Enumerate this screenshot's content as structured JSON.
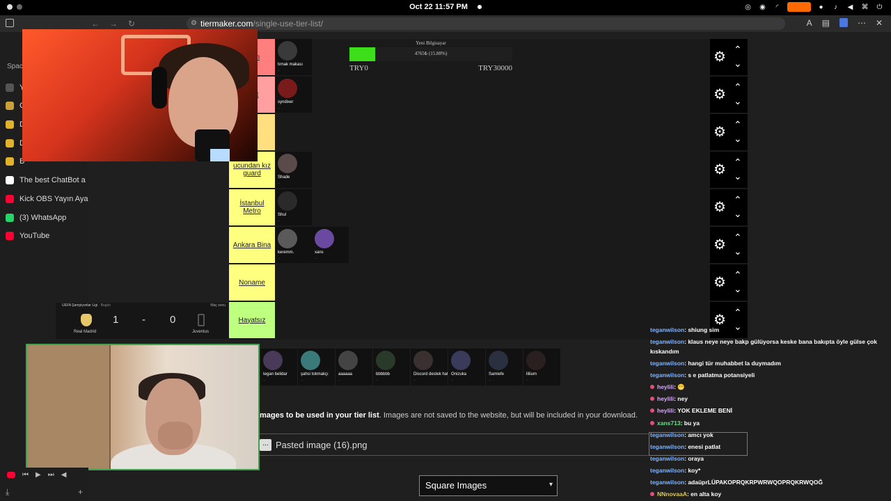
{
  "os": {
    "clock": "Oct 22  11:57 PM"
  },
  "browser": {
    "url_domain": "tiermaker.com",
    "url_path": "/single-use-tier-list/",
    "nav_back": "←",
    "nav_forward": "→",
    "reload": "↻",
    "close": "✕",
    "more": "⋯"
  },
  "sidebar": {
    "spaces_label": "Spac",
    "items": [
      {
        "label": "Y",
        "icon": "plus-icon"
      },
      {
        "label": "C",
        "icon": "tab-icon"
      },
      {
        "label": "D",
        "icon": "favicon"
      },
      {
        "label": "D",
        "icon": "favicon"
      },
      {
        "label": "B",
        "icon": "favicon"
      },
      {
        "label": "The best ChatBot a",
        "icon": "chatbot-icon"
      },
      {
        "label": "Kick OBS Yayın Aya",
        "icon": "youtube-icon"
      },
      {
        "label": "(3) WhatsApp",
        "icon": "whatsapp-icon"
      },
      {
        "label": "YouTube",
        "icon": "youtube-icon"
      }
    ],
    "download": "⤓",
    "add": "+"
  },
  "tiers": [
    {
      "label": "nden",
      "color": "#ff7f7f",
      "items": [
        {
          "name": "tırnak makası",
          "sub": "..."
        }
      ]
    },
    {
      "label": "ayat",
      "color": "#ff9f9f",
      "items": [
        {
          "name": "syndixer",
          "sub": "..."
        }
      ]
    },
    {
      "label": "",
      "color": "#ffdf80",
      "items": []
    },
    {
      "label": "ucundan kız guard",
      "color": "#ffff7f",
      "items": [
        {
          "name": "Shade",
          "sub": "..."
        }
      ]
    },
    {
      "label": "İstanbul Metro",
      "color": "#ffff7f",
      "items": [
        {
          "name": "Shul",
          "sub": "..."
        }
      ]
    },
    {
      "label": "Ankara Bina",
      "color": "#ffff7f",
      "items": [
        {
          "name": "keremm.",
          "sub": "..."
        },
        {
          "name": "xans",
          "sub": "..."
        }
      ]
    },
    {
      "label": "Noname",
      "color": "#ffff7f",
      "items": []
    },
    {
      "label": "Hayatsız",
      "color": "#bfff7f",
      "items": []
    }
  ],
  "donation": {
    "title": "Yeni Bilgisayar",
    "progress_text": "4765₺ (15.88%)",
    "progress": 0.1588,
    "min_label": "TRY0",
    "max_label": "TRY30000",
    "fill_color": "#3ddf1a"
  },
  "pool": [
    {
      "name": "tegan belidar",
      "sub": "..."
    },
    {
      "name": "şahsi tokmakçı",
      "sub": "..."
    },
    {
      "name": "aaaaaa",
      "sub": "..."
    },
    {
      "name": "bbbbbb",
      "sub": "..."
    },
    {
      "name": "Discord destek hattı",
      "sub": "..."
    },
    {
      "name": "Onizuka",
      "sub": "..."
    },
    {
      "name": "Samiefe",
      "sub": "..."
    },
    {
      "name": "liliium",
      "sub": "..."
    }
  ],
  "upload": {
    "bold": "mages to be used in your tier list",
    "rest": ". Images are not saved to the website, but will be included in your download.",
    "file_button": "...",
    "file_name": "Pasted image (16).png"
  },
  "select": {
    "value": "Square Images"
  },
  "scoreboard": {
    "league": "UEFA Şampiyonlar Ligi",
    "league_time": "· Bugün",
    "status": "Maç sonu",
    "team1": "Real Madrid",
    "team2": "Juventus",
    "score1": "1",
    "separator": "-",
    "score2": "0"
  },
  "chat": [
    {
      "user": "teganwilson",
      "text": ": shiung sim"
    },
    {
      "user": "teganwilson",
      "text": ": klaus neye neye bakp gülüyorsa keske bana bakıpta öyle gülse çok kıskandım"
    },
    {
      "user": "teganwilson",
      "text": ": hangi tür muhabbet la duymadım"
    },
    {
      "user": "teganwilson",
      "text": ": s e patlatma potansiyeli"
    },
    {
      "user": "heylili",
      "text": ": 😬"
    },
    {
      "user": "heylili",
      "text": ": ney"
    },
    {
      "user": "heylili",
      "text": ": YOK EKLEME BENİ"
    },
    {
      "user": "xans713",
      "text": ": bu ya"
    },
    {
      "user": "teganwilson",
      "text": ": amcı yok"
    },
    {
      "user": "teganwilson",
      "text": ": enesi patlat"
    },
    {
      "user": "teganwilson",
      "text": ": oraya"
    },
    {
      "user": "teganwilson",
      "text": ": koy*"
    },
    {
      "user": "teganwilson",
      "text": ": adaüprLÜPAKOPRQKRPWRWQOPRQKRWQOĞ"
    },
    {
      "user": "NNnovaaA",
      "text": ": en alta koy"
    }
  ],
  "chat_colors": {
    "teganwilson": "#7fb3ff",
    "heylili": "#d7a6ff",
    "xans713": "#66e08a",
    "NNnovaaA": "#e0c84a"
  }
}
